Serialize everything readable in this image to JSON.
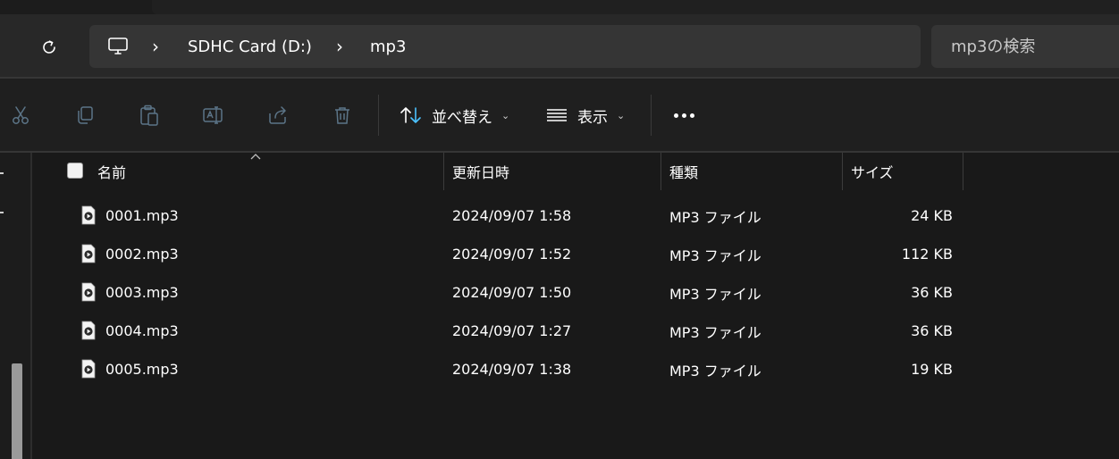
{
  "address": {
    "segments": [
      "SDHC Card (D:)",
      "mp3"
    ],
    "separator": "›"
  },
  "search": {
    "placeholder": "mp3の検索"
  },
  "toolbar": {
    "sort_label": "並べ替え",
    "view_label": "表示",
    "dropdown_chevron": "⌄"
  },
  "columns": {
    "name": "名前",
    "date": "更新日時",
    "type": "種類",
    "size": "サイズ"
  },
  "files": [
    {
      "name": "0001.mp3",
      "date": "2024/09/07 1:58",
      "type": "MP3 ファイル",
      "size": "24 KB"
    },
    {
      "name": "0002.mp3",
      "date": "2024/09/07 1:52",
      "type": "MP3 ファイル",
      "size": "112 KB"
    },
    {
      "name": "0003.mp3",
      "date": "2024/09/07 1:50",
      "type": "MP3 ファイル",
      "size": "36 KB"
    },
    {
      "name": "0004.mp3",
      "date": "2024/09/07 1:27",
      "type": "MP3 ファイル",
      "size": "36 KB"
    },
    {
      "name": "0005.mp3",
      "date": "2024/09/07 1:38",
      "type": "MP3 ファイル",
      "size": "19 KB"
    }
  ],
  "icons": {
    "refresh": "refresh-icon",
    "this_pc": "monitor-icon",
    "cut": "scissors-icon",
    "copy": "copy-icon",
    "paste": "clipboard-icon",
    "rename": "rename-icon",
    "share": "share-icon",
    "delete": "trash-icon",
    "sort": "sort-arrows-icon",
    "view": "list-view-icon",
    "more": "more-dots-icon",
    "file": "mp3-file-icon"
  },
  "colors": {
    "background": "#191919",
    "address_bar": "#353535",
    "sort_accent": "#4cc2ff",
    "disabled_icon": "#5c7588",
    "file_icon_accent": "#b0305c"
  }
}
